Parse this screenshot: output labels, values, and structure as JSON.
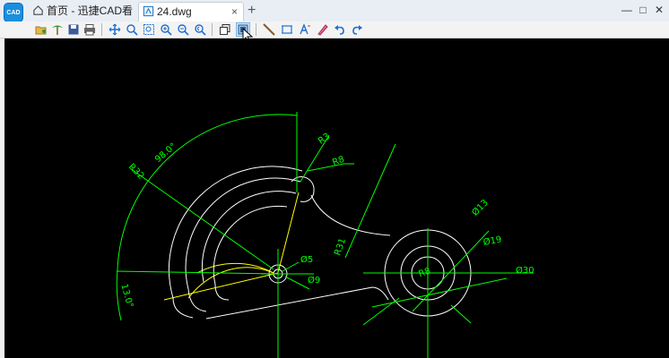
{
  "titlebar": {
    "home_tab_label": "首页 - 迅捷CAD看图",
    "doc_tab_label": "24.dwg",
    "new_tab_glyph": "+",
    "tab_close_glyph": "×",
    "logo_text": "CAD",
    "minimize_glyph": "—",
    "maximize_glyph": "□",
    "close_glyph": "✕"
  },
  "toolbar": {
    "icons": [
      "open-icon",
      "tree-icon",
      "save-icon",
      "print-icon",
      "pan-icon",
      "zoom-window-icon",
      "zoom-extents-icon",
      "zoom-in-icon",
      "zoom-out-icon",
      "zoom-previous-icon",
      "layers-icon",
      "view-3d-icon",
      "measure-line-icon",
      "measure-area-icon",
      "text-icon",
      "markup-icon",
      "undo-icon",
      "redo-icon"
    ]
  },
  "colors": {
    "canvas_bg": "#000000",
    "dimension": "#00ff00",
    "geometry": "#ffffff",
    "construction": "#ffff00",
    "accent": "#1a8fe0"
  },
  "drawing": {
    "dimensions": {
      "angle_98": "98.0°",
      "angle_13": "13.0°",
      "radius_32": "R32",
      "radius_3": "R3",
      "radius_8": "R8",
      "radius_31": "R31",
      "radius_8_center": "R8",
      "dia_5": "Ø5",
      "dia_9": "Ø9",
      "dia_13": "Ø13",
      "dia_19": "Ø19",
      "dia_30": "Ø30"
    }
  }
}
